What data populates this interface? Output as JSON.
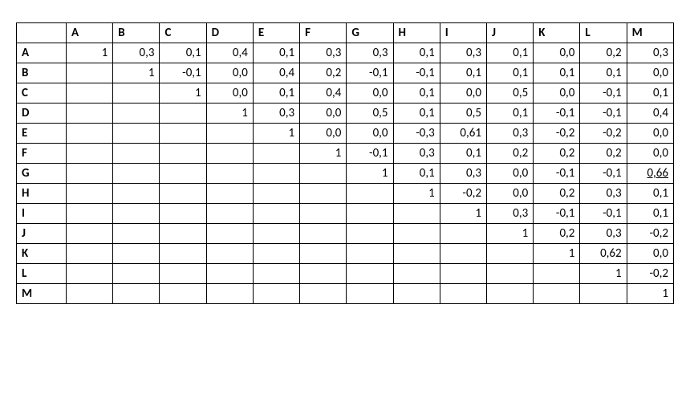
{
  "chart_data": {
    "type": "table",
    "title": "",
    "row_labels": [
      "A",
      "B",
      "C",
      "D",
      "E",
      "F",
      "G",
      "H",
      "I",
      "J",
      "K",
      "L",
      "M"
    ],
    "col_labels": [
      "A",
      "B",
      "C",
      "D",
      "E",
      "F",
      "G",
      "H",
      "I",
      "J",
      "K",
      "L",
      "M"
    ],
    "cells": [
      [
        "1",
        "0,3",
        "0,1",
        "0,4",
        "0,1",
        "0,3",
        "0,3",
        "0,1",
        "0,3",
        "0,1",
        "0,0",
        "0,2",
        "0,3"
      ],
      [
        "",
        "1",
        "-0,1",
        "0,0",
        "0,4",
        "0,2",
        "-0,1",
        "-0,1",
        "0,1",
        "0,1",
        "0,1",
        "0,1",
        "0,0"
      ],
      [
        "",
        "",
        "1",
        "0,0",
        "0,1",
        "0,4",
        "0,0",
        "0,1",
        "0,0",
        "0,5",
        "0,0",
        "-0,1",
        "0,1"
      ],
      [
        "",
        "",
        "",
        "1",
        "0,3",
        "0,0",
        "0,5",
        "0,1",
        "0,5",
        "0,1",
        "-0,1",
        "-0,1",
        "0,4"
      ],
      [
        "",
        "",
        "",
        "",
        "1",
        "0,0",
        "0,0",
        "-0,3",
        "0,61",
        "0,3",
        "-0,2",
        "-0,2",
        "0,0"
      ],
      [
        "",
        "",
        "",
        "",
        "",
        "1",
        "-0,1",
        "0,3",
        "0,1",
        "0,2",
        "0,2",
        "0,2",
        "0,0"
      ],
      [
        "",
        "",
        "",
        "",
        "",
        "",
        "1",
        "0,1",
        "0,3",
        "0,0",
        "-0,1",
        "-0,1",
        "0,66"
      ],
      [
        "",
        "",
        "",
        "",
        "",
        "",
        "",
        "1",
        "-0,2",
        "0,0",
        "0,2",
        "0,3",
        "0,1"
      ],
      [
        "",
        "",
        "",
        "",
        "",
        "",
        "",
        "",
        "1",
        "0,3",
        "-0,1",
        "-0,1",
        "0,1"
      ],
      [
        "",
        "",
        "",
        "",
        "",
        "",
        "",
        "",
        "",
        "1",
        "0,2",
        "0,3",
        "-0,2"
      ],
      [
        "",
        "",
        "",
        "",
        "",
        "",
        "",
        "",
        "",
        "",
        "1",
        "0,62",
        "0,0"
      ],
      [
        "",
        "",
        "",
        "",
        "",
        "",
        "",
        "",
        "",
        "",
        "",
        "1",
        "-0,2"
      ],
      [
        "",
        "",
        "",
        "",
        "",
        "",
        "",
        "",
        "",
        "",
        "",
        "",
        "1"
      ]
    ],
    "underlined": [
      [
        6,
        12
      ]
    ]
  }
}
